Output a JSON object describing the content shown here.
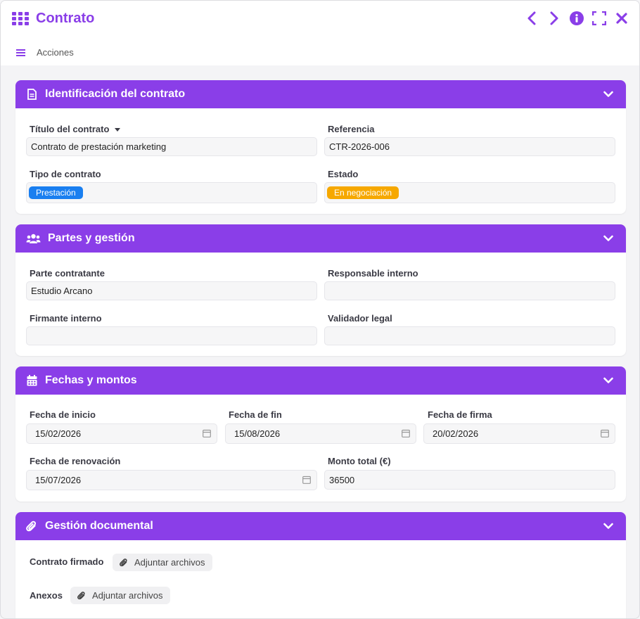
{
  "app": {
    "title": "Contrato",
    "menu_label": "Acciones",
    "accent_color": "#8a3ee8"
  },
  "window_buttons": [
    "chevron-left-icon",
    "chevron-right-icon",
    "info-icon",
    "fullscreen-icon",
    "close-icon"
  ],
  "sections": {
    "identificacion": {
      "title": "Identificación del contrato",
      "icon": "document-icon",
      "titulo_label": "Título del contrato",
      "titulo_value": "Contrato de prestación marketing",
      "referencia_label": "Referencia",
      "referencia_value": "CTR-2026-006",
      "tipo_label": "Tipo de contrato",
      "tipo_value": "Prestación",
      "tipo_color": "#1a7ff0",
      "estado_label": "Estado",
      "estado_value": "En negociación",
      "estado_color": "#f6a800"
    },
    "partes": {
      "title": "Partes y gestión",
      "icon": "users-icon",
      "parte_label": "Parte contratante",
      "parte_value": "Estudio Arcano",
      "responsable_label": "Responsable interno",
      "responsable_value": "",
      "firmante_label": "Firmante interno",
      "firmante_value": "",
      "validador_label": "Validador legal",
      "validador_value": ""
    },
    "fechas": {
      "title": "Fechas y montos",
      "icon": "calendar-icon",
      "inicio_label": "Fecha de inicio",
      "inicio_value": "15/02/2026",
      "fin_label": "Fecha de fin",
      "fin_value": "15/08/2026",
      "firma_label": "Fecha de firma",
      "firma_value": "20/02/2026",
      "renovacion_label": "Fecha de renovación",
      "renovacion_value": "15/07/2026",
      "monto_label": "Monto total (€)",
      "monto_value": "36500"
    },
    "documental": {
      "title": "Gestión documental",
      "icon": "paperclip-icon",
      "firmado_label": "Contrato firmado",
      "anexos_label": "Anexos",
      "attach_label": "Adjuntar archivos"
    }
  }
}
